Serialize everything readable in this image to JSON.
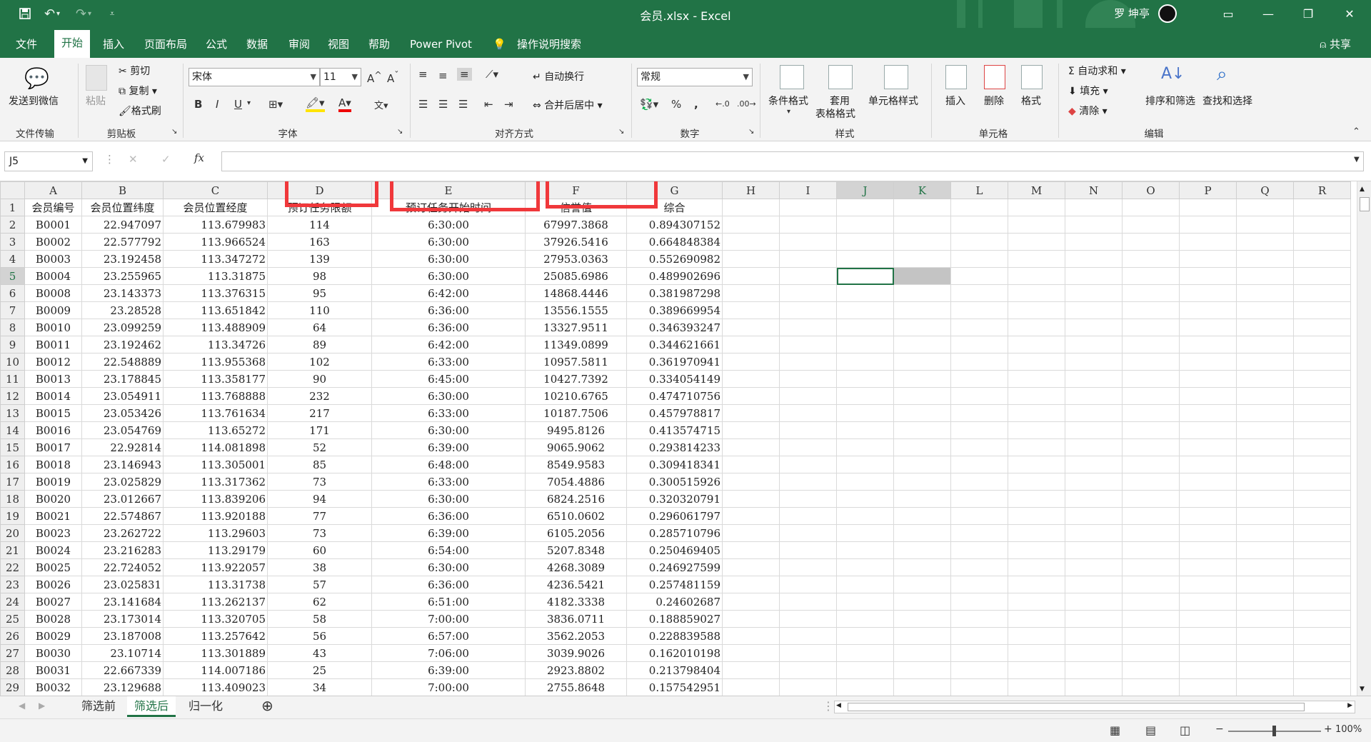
{
  "window": {
    "title": "会员.xlsx  -  Excel",
    "user": "罗 坤亭",
    "share_label": "共享"
  },
  "quick_access": [
    "save-icon",
    "undo-icon",
    "redo-icon",
    "customize-icon"
  ],
  "tabs": [
    "文件",
    "开始",
    "插入",
    "页面布局",
    "公式",
    "数据",
    "审阅",
    "视图",
    "帮助",
    "Power Pivot",
    "操作说明搜索"
  ],
  "ribbon": {
    "wechat": {
      "label": "发送到微信",
      "group": "文件传输"
    },
    "clipboard": {
      "paste": "粘贴",
      "cut": "剪切",
      "copy": "复制",
      "format_painter": "格式刷",
      "group": "剪贴板"
    },
    "font": {
      "name": "宋体",
      "size": "11",
      "bold": "B",
      "italic": "I",
      "underline": "U",
      "group": "字体"
    },
    "alignment": {
      "wrap": "自动换行",
      "merge": "合并后居中",
      "group": "对齐方式"
    },
    "number": {
      "format": "常规",
      "percent": "%",
      "comma": ",",
      "group": "数字"
    },
    "styles": {
      "conditional": "条件格式",
      "table": "套用",
      "table2": "表格格式",
      "cell_styles": "单元格样式",
      "group": "样式"
    },
    "cells": {
      "insert": "插入",
      "delete": "删除",
      "format": "格式",
      "group": "单元格"
    },
    "editing": {
      "autosum": "自动求和",
      "fill": "填充",
      "clear": "清除",
      "sort": "排序和筛选",
      "find": "查找和选择",
      "group": "编辑"
    }
  },
  "formula_bar": {
    "name_box": "J5",
    "formula": ""
  },
  "columns": [
    "A",
    "B",
    "C",
    "D",
    "E",
    "F",
    "G",
    "H",
    "I",
    "J",
    "K",
    "L",
    "M",
    "N",
    "O",
    "P",
    "Q",
    "R"
  ],
  "headers": [
    "会员编号",
    "会员位置纬度",
    "会员位置经度",
    "预订任务限额",
    "预订任务开始时间",
    "信誉值",
    "综合"
  ],
  "rows": [
    [
      "B0001",
      "22.947097",
      "113.679983",
      "114",
      "6:30:00",
      "67997.3868",
      "0.894307152"
    ],
    [
      "B0002",
      "22.577792",
      "113.966524",
      "163",
      "6:30:00",
      "37926.5416",
      "0.664848384"
    ],
    [
      "B0003",
      "23.192458",
      "113.347272",
      "139",
      "6:30:00",
      "27953.0363",
      "0.552690982"
    ],
    [
      "B0004",
      "23.255965",
      "113.31875",
      "98",
      "6:30:00",
      "25085.6986",
      "0.489902696"
    ],
    [
      "B0008",
      "23.143373",
      "113.376315",
      "95",
      "6:42:00",
      "14868.4446",
      "0.381987298"
    ],
    [
      "B0009",
      "23.28528",
      "113.651842",
      "110",
      "6:36:00",
      "13556.1555",
      "0.389669954"
    ],
    [
      "B0010",
      "23.099259",
      "113.488909",
      "64",
      "6:36:00",
      "13327.9511",
      "0.346393247"
    ],
    [
      "B0011",
      "23.192462",
      "113.34726",
      "89",
      "6:42:00",
      "11349.0899",
      "0.344621661"
    ],
    [
      "B0012",
      "22.548889",
      "113.955368",
      "102",
      "6:33:00",
      "10957.5811",
      "0.361970941"
    ],
    [
      "B0013",
      "23.178845",
      "113.358177",
      "90",
      "6:45:00",
      "10427.7392",
      "0.334054149"
    ],
    [
      "B0014",
      "23.054911",
      "113.768888",
      "232",
      "6:30:00",
      "10210.6765",
      "0.474710756"
    ],
    [
      "B0015",
      "23.053426",
      "113.761634",
      "217",
      "6:33:00",
      "10187.7506",
      "0.457978817"
    ],
    [
      "B0016",
      "23.054769",
      "113.65272",
      "171",
      "6:30:00",
      "9495.8126",
      "0.413574715"
    ],
    [
      "B0017",
      "22.92814",
      "114.081898",
      "52",
      "6:39:00",
      "9065.9062",
      "0.293814233"
    ],
    [
      "B0018",
      "23.146943",
      "113.305001",
      "85",
      "6:48:00",
      "8549.9583",
      "0.309418341"
    ],
    [
      "B0019",
      "23.025829",
      "113.317362",
      "73",
      "6:33:00",
      "7054.4886",
      "0.300515926"
    ],
    [
      "B0020",
      "23.012667",
      "113.839206",
      "94",
      "6:30:00",
      "6824.2516",
      "0.320320791"
    ],
    [
      "B0021",
      "22.574867",
      "113.920188",
      "77",
      "6:36:00",
      "6510.0602",
      "0.296061797"
    ],
    [
      "B0023",
      "23.262722",
      "113.29603",
      "73",
      "6:39:00",
      "6105.2056",
      "0.285710796"
    ],
    [
      "B0024",
      "23.216283",
      "113.29179",
      "60",
      "6:54:00",
      "5207.8348",
      "0.250469405"
    ],
    [
      "B0025",
      "22.724052",
      "113.922057",
      "38",
      "6:30:00",
      "4268.3089",
      "0.246927599"
    ],
    [
      "B0026",
      "23.025831",
      "113.31738",
      "57",
      "6:36:00",
      "4236.5421",
      "0.257481159"
    ],
    [
      "B0027",
      "23.141684",
      "113.262137",
      "62",
      "6:51:00",
      "4182.3338",
      "0.24602687"
    ],
    [
      "B0028",
      "23.173014",
      "113.320705",
      "58",
      "7:00:00",
      "3836.0711",
      "0.188859027"
    ],
    [
      "B0029",
      "23.187008",
      "113.257642",
      "56",
      "6:57:00",
      "3562.2053",
      "0.228839588"
    ],
    [
      "B0030",
      "23.10714",
      "113.301889",
      "43",
      "7:06:00",
      "3039.9026",
      "0.162010198"
    ],
    [
      "B0031",
      "22.667339",
      "114.007186",
      "25",
      "6:39:00",
      "2923.8802",
      "0.213798404"
    ],
    [
      "B0032",
      "23.129688",
      "113.409023",
      "34",
      "7:00:00",
      "2755.8648",
      "0.157542951"
    ]
  ],
  "sheets": [
    "筛选前",
    "筛选后",
    "归一化"
  ],
  "active_sheet": "筛选后",
  "status": {
    "zoom": "100%"
  },
  "colors": {
    "excel_green": "#217346",
    "highlight_red": "#f0383b"
  }
}
